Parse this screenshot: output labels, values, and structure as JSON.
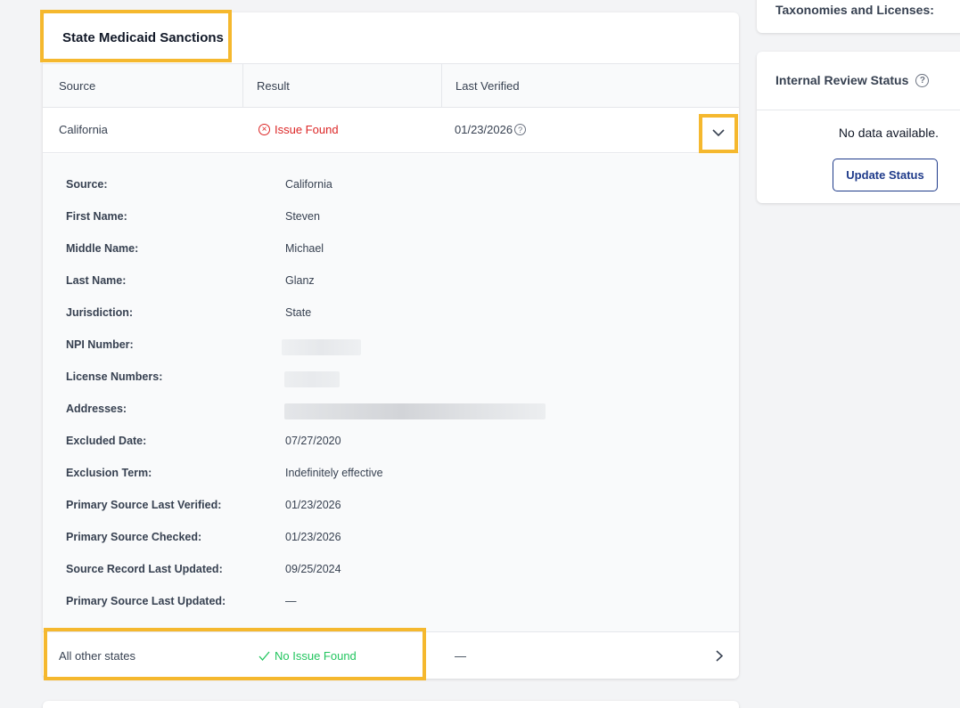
{
  "card": {
    "title": "State Medicaid Sanctions"
  },
  "table": {
    "headers": [
      "Source",
      "Result",
      "Last Verified"
    ],
    "row1": {
      "source": "California",
      "result": "Issue Found",
      "last_verified": "01/23/2026"
    },
    "row2": {
      "source": "All other states",
      "result": "No Issue Found",
      "last_verified": "—"
    }
  },
  "details": [
    {
      "label": "Source:",
      "value": "California"
    },
    {
      "label": "First Name:",
      "value": "Steven"
    },
    {
      "label": "Middle Name:",
      "value": "Michael"
    },
    {
      "label": "Last Name:",
      "value": "Glanz"
    },
    {
      "label": "Jurisdiction:",
      "value": "State"
    },
    {
      "label": "NPI Number:",
      "value": ""
    },
    {
      "label": "License Numbers:",
      "value": ""
    },
    {
      "label": "Addresses:",
      "value": ""
    },
    {
      "label": "Excluded Date:",
      "value": "07/27/2020"
    },
    {
      "label": "Exclusion Term:",
      "value": "Indefinitely effective"
    },
    {
      "label": "Primary Source Last Verified:",
      "value": "01/23/2026"
    },
    {
      "label": "Primary Source Checked:",
      "value": "01/23/2026"
    },
    {
      "label": "Source Record Last Updated:",
      "value": "09/25/2024"
    },
    {
      "label": "Primary Source Last Updated:",
      "value": "—"
    }
  ],
  "side": {
    "top_title": "Taxonomies and Licenses:",
    "review_title": "Internal Review Status",
    "no_data": "No data available.",
    "update_button": "Update Status"
  },
  "colors": {
    "highlight": "#f5b82e",
    "error": "#dc2626",
    "success": "#22c55e",
    "button": "#1e3a8a"
  }
}
